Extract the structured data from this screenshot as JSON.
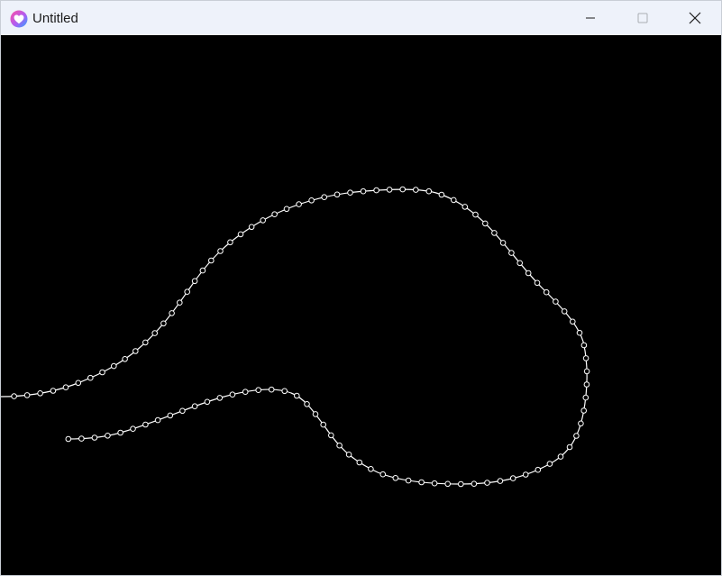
{
  "window": {
    "title": "Untitled",
    "controls": [
      "minimize",
      "maximize",
      "close"
    ],
    "icon": "app-heart-icon"
  },
  "canvas": {
    "background": "#000000",
    "curve_color": "#ffffff",
    "marker_style": "hollow-circle"
  }
}
